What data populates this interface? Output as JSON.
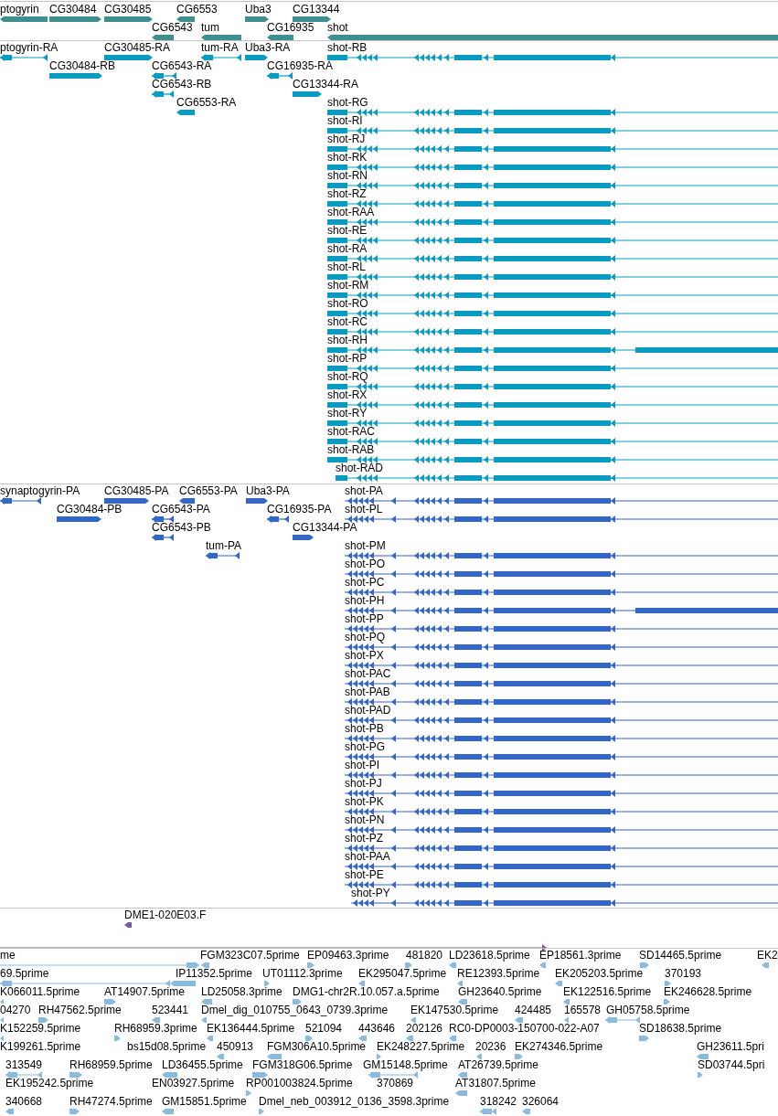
{
  "tracks": [
    {
      "kind": "genes",
      "features": [
        {
          "label": "ptogyrin",
          "reverse": true
        },
        {
          "label": "CG30484",
          "reverse": false
        },
        {
          "label": "CG30485",
          "reverse": false
        },
        {
          "label": "CG6553",
          "reverse": true
        },
        {
          "label": "Uba3",
          "reverse": false
        },
        {
          "label": "CG13344",
          "reverse": false
        },
        {
          "label": "CG6543",
          "reverse": true
        },
        {
          "label": "tum",
          "reverse": true
        },
        {
          "label": "CG16935",
          "reverse": true
        },
        {
          "label": "shot",
          "reverse": true
        }
      ]
    },
    {
      "kind": "transcripts",
      "features": [
        {
          "label": "ptogyrin-RA",
          "reverse": true
        },
        {
          "label": "CG30485-RA",
          "reverse": false
        },
        {
          "label": "tum-RA",
          "reverse": true
        },
        {
          "label": "Uba3-RA",
          "reverse": false
        },
        {
          "label": "shot-RB",
          "reverse": true
        },
        {
          "label": "CG30484-RB",
          "reverse": false
        },
        {
          "label": "CG6543-RA",
          "reverse": true
        },
        {
          "label": "CG16935-RA",
          "reverse": true
        },
        {
          "label": "CG6543-RB",
          "reverse": true
        },
        {
          "label": "CG13344-RA",
          "reverse": false
        },
        {
          "label": "CG6553-RA",
          "reverse": true
        },
        {
          "label": "shot-RG",
          "reverse": true
        },
        {
          "label": "shot-RI",
          "reverse": true
        },
        {
          "label": "shot-RJ",
          "reverse": true
        },
        {
          "label": "shot-RK",
          "reverse": true
        },
        {
          "label": "shot-RN",
          "reverse": true
        },
        {
          "label": "shot-RZ",
          "reverse": true
        },
        {
          "label": "shot-RAA",
          "reverse": true
        },
        {
          "label": "shot-RE",
          "reverse": true
        },
        {
          "label": "shot-RA",
          "reverse": true
        },
        {
          "label": "shot-RL",
          "reverse": true
        },
        {
          "label": "shot-RM",
          "reverse": true
        },
        {
          "label": "shot-RO",
          "reverse": true
        },
        {
          "label": "shot-RC",
          "reverse": true
        },
        {
          "label": "shot-RH",
          "reverse": true
        },
        {
          "label": "shot-RP",
          "reverse": true
        },
        {
          "label": "shot-RQ",
          "reverse": true
        },
        {
          "label": "shot-RX",
          "reverse": true
        },
        {
          "label": "shot-RY",
          "reverse": true
        },
        {
          "label": "shot-RAC",
          "reverse": true
        },
        {
          "label": "shot-RAB",
          "reverse": true
        },
        {
          "label": "shot-RAD",
          "reverse": true
        }
      ]
    },
    {
      "kind": "proteins",
      "features": [
        {
          "label": "synaptogyrin-PA",
          "reverse": true
        },
        {
          "label": "CG30485-PA",
          "reverse": false
        },
        {
          "label": "CG6553-PA",
          "reverse": true
        },
        {
          "label": "Uba3-PA",
          "reverse": false
        },
        {
          "label": "shot-PA",
          "reverse": true
        },
        {
          "label": "CG30484-PB",
          "reverse": false
        },
        {
          "label": "CG6543-PA",
          "reverse": true
        },
        {
          "label": "CG16935-PA",
          "reverse": true
        },
        {
          "label": "shot-PL",
          "reverse": true
        },
        {
          "label": "CG6543-PB",
          "reverse": true
        },
        {
          "label": "CG13344-PA",
          "reverse": false
        },
        {
          "label": "tum-PA",
          "reverse": true
        },
        {
          "label": "shot-PM",
          "reverse": true
        },
        {
          "label": "shot-PO",
          "reverse": true
        },
        {
          "label": "shot-PC",
          "reverse": true
        },
        {
          "label": "shot-PH",
          "reverse": true
        },
        {
          "label": "shot-PP",
          "reverse": true
        },
        {
          "label": "shot-PQ",
          "reverse": true
        },
        {
          "label": "shot-PX",
          "reverse": true
        },
        {
          "label": "shot-PAC",
          "reverse": true
        },
        {
          "label": "shot-PAB",
          "reverse": true
        },
        {
          "label": "shot-PAD",
          "reverse": true
        },
        {
          "label": "shot-PB",
          "reverse": true
        },
        {
          "label": "shot-PG",
          "reverse": true
        },
        {
          "label": "shot-PI",
          "reverse": true
        },
        {
          "label": "shot-PJ",
          "reverse": true
        },
        {
          "label": "shot-PK",
          "reverse": true
        },
        {
          "label": "shot-PN",
          "reverse": true
        },
        {
          "label": "shot-PZ",
          "reverse": true
        },
        {
          "label": "shot-PAA",
          "reverse": true
        },
        {
          "label": "shot-PE",
          "reverse": true
        },
        {
          "label": "shot-PY",
          "reverse": true
        }
      ]
    },
    {
      "kind": "clones",
      "features": [
        {
          "label": "DME1-020E03.F",
          "reverse": true
        },
        {
          "reverse": false
        }
      ]
    },
    {
      "kind": "ests",
      "features": [
        {
          "label": "me",
          "reverse": false
        },
        {
          "label": "FGM323C07.5prime",
          "reverse": true
        },
        {
          "label": "EP09463.3prime",
          "reverse": false
        },
        {
          "label": "481820",
          "reverse": false
        },
        {
          "label": "LD23618.5prime",
          "reverse": true
        },
        {
          "label": "EP18561.3prime",
          "reverse": true
        },
        {
          "label": "SD14465.5prime",
          "reverse": false
        },
        {
          "label": "EK2",
          "reverse": true
        },
        {
          "label": "69.5prime",
          "reverse": true
        },
        {
          "label": "IP11352.5prime",
          "reverse": true
        },
        {
          "label": "UT01112.3prime",
          "reverse": false
        },
        {
          "label": "EK295047.5prime",
          "reverse": true
        },
        {
          "label": "RE12393.5prime",
          "reverse": true
        },
        {
          "label": "EK205203.5prime",
          "reverse": true
        },
        {
          "label": "370193",
          "reverse": false
        },
        {
          "label": "K066011.5prime",
          "reverse": true
        },
        {
          "label": "AT14907.5prime",
          "reverse": false
        },
        {
          "label": "LD25058.3prime",
          "reverse": true
        },
        {
          "label": "DMG1-chr2R.10.057.a.5prime",
          "reverse": false
        },
        {
          "label": "GH23640.5prime",
          "reverse": true
        },
        {
          "label": "EK122516.5prime",
          "reverse": true
        },
        {
          "label": "EK246628.5prime",
          "reverse": false
        },
        {
          "label": "04270",
          "reverse": true
        },
        {
          "label": "RH47562.5prime",
          "reverse": false
        },
        {
          "label": "523441",
          "reverse": true
        },
        {
          "label": "Dmel_dig_010755_0643_0739.3prime",
          "reverse": true
        },
        {
          "label": "EK147530.5prime",
          "reverse": true
        },
        {
          "label": "424485",
          "reverse": true
        },
        {
          "label": "165578",
          "reverse": true
        },
        {
          "label": "GH05758.5prime",
          "reverse": true
        },
        {
          "label": "K152259.5prime",
          "reverse": true
        },
        {
          "label": "RH68959.3prime",
          "reverse": false
        },
        {
          "label": "EK136444.5prime",
          "reverse": true
        },
        {
          "label": "521094",
          "reverse": false
        },
        {
          "label": "443646",
          "reverse": true
        },
        {
          "label": "202126",
          "reverse": true
        },
        {
          "label": "RC0-DP0003-150700-022-A07",
          "reverse": true
        },
        {
          "label": "SD18638.5prime",
          "reverse": false
        },
        {
          "label": "K199261.5prime"
        },
        {
          "label": "bs15d08.5prime"
        },
        {
          "label": "450913",
          "reverse": true
        },
        {
          "label": "FGM306A10.5prime",
          "reverse": true
        },
        {
          "label": "EK248227.5prime",
          "reverse": false
        },
        {
          "label": "20236",
          "reverse": true
        },
        {
          "label": "EK274346.5prime",
          "reverse": false
        },
        {
          "label": "GH23611.5pri",
          "reverse": true
        },
        {
          "label": "313549",
          "reverse": true
        },
        {
          "label": "RH68959.5prime",
          "reverse": false
        },
        {
          "label": "LD36455.5prime",
          "reverse": true
        },
        {
          "label": "FGM318G06.5prime",
          "reverse": false
        },
        {
          "label": "GM15148.5prime",
          "reverse": true
        },
        {
          "label": "AT26739.5prime",
          "reverse": true
        },
        {
          "label": "SD03744.5pri",
          "reverse": false
        },
        {
          "label": "EK195242.5prime"
        },
        {
          "label": "EN03927.5prime"
        },
        {
          "label": "RP001003824.5prime",
          "reverse": false
        },
        {
          "label": "370869"
        },
        {
          "label": "AT31807.5prime",
          "reverse": true
        },
        {
          "label": "340668",
          "reverse": true
        },
        {
          "label": "RH47274.5prime",
          "reverse": false
        },
        {
          "label": "GM15851.5prime",
          "reverse": true
        },
        {
          "label": "Dmel_neb_003912_0136_3598.3prime",
          "reverse": false
        },
        {
          "label": "318242",
          "reverse": true
        },
        {
          "label": "326064",
          "reverse": true
        }
      ]
    }
  ]
}
